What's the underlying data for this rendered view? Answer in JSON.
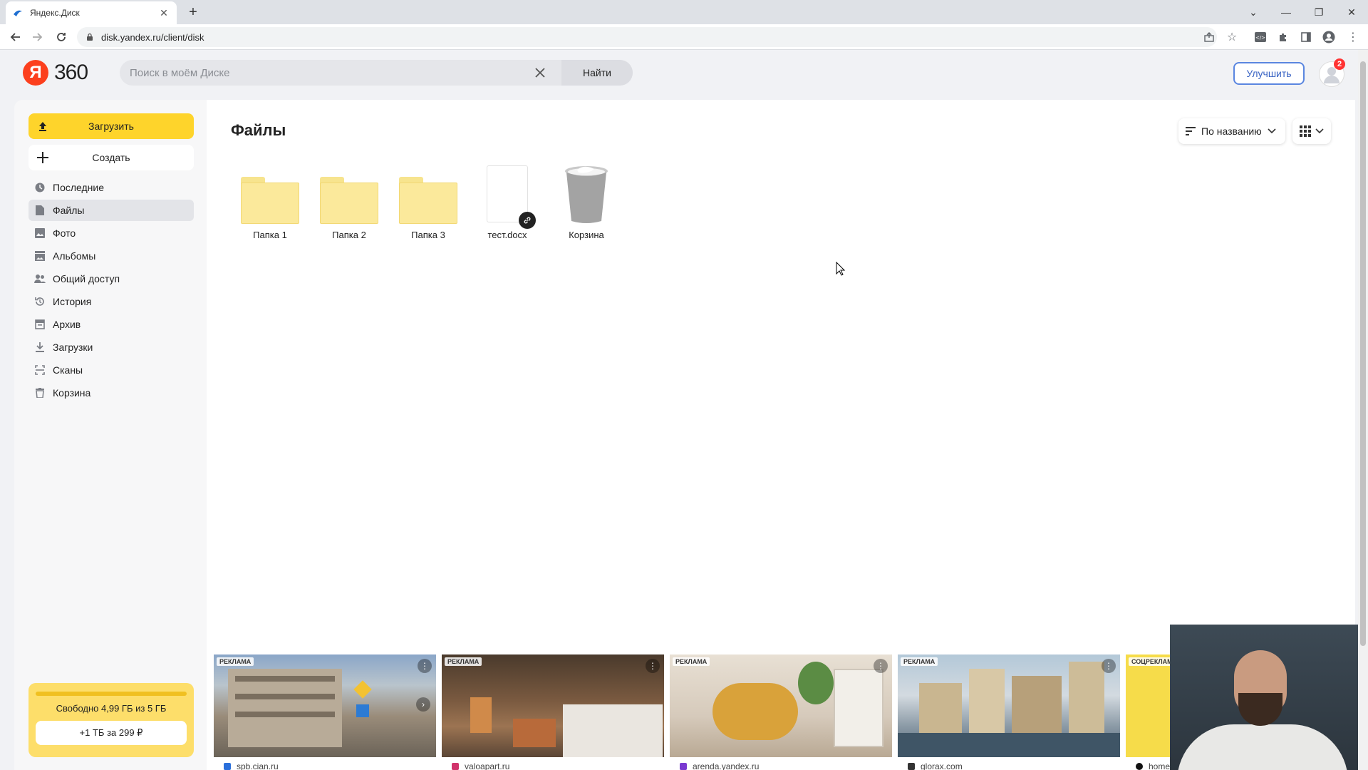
{
  "browser": {
    "tab_title": "Яндекс.Диск",
    "url": "disk.yandex.ru/client/disk"
  },
  "header": {
    "logo_letter": "Я",
    "logo_text": "360",
    "search_placeholder": "Поиск в моём Диске",
    "search_button": "Найти",
    "upgrade_label": "Улучшить",
    "notification_count": "2"
  },
  "sidebar": {
    "upload_label": "Загрузить",
    "create_label": "Создать",
    "items": [
      {
        "label": "Последние",
        "icon": "clock-icon"
      },
      {
        "label": "Файлы",
        "icon": "file-icon"
      },
      {
        "label": "Фото",
        "icon": "photo-icon"
      },
      {
        "label": "Альбомы",
        "icon": "album-icon"
      },
      {
        "label": "Общий доступ",
        "icon": "people-icon"
      },
      {
        "label": "История",
        "icon": "history-icon"
      },
      {
        "label": "Архив",
        "icon": "archive-icon"
      },
      {
        "label": "Загрузки",
        "icon": "download-icon"
      },
      {
        "label": "Сканы",
        "icon": "scan-icon"
      },
      {
        "label": "Корзина",
        "icon": "trash-icon"
      }
    ],
    "active_item": "Файлы",
    "storage_text": "Свободно 4,99 ГБ из 5 ГБ",
    "storage_offer": "+1 ТБ за 299 ₽"
  },
  "main": {
    "title": "Файлы",
    "sort_label": "По названию",
    "files": [
      {
        "name": "Папка 1",
        "type": "folder"
      },
      {
        "name": "Папка 2",
        "type": "folder"
      },
      {
        "name": "Папка 3",
        "type": "folder"
      },
      {
        "name": "тест.docx",
        "type": "document",
        "shared_link": true
      },
      {
        "name": "Корзина",
        "type": "trash"
      }
    ]
  },
  "ads": [
    {
      "label": "РЕКЛАМА",
      "domain": "spb.cian.ru"
    },
    {
      "label": "РЕКЛАМА",
      "domain": "valoapart.ru"
    },
    {
      "label": "РЕКЛАМА",
      "domain": "arenda.yandex.ru"
    },
    {
      "label": "РЕКЛАМА",
      "domain": "glorax.com"
    },
    {
      "label": "СОЦРЕКЛАМ",
      "domain": "home"
    }
  ],
  "colors": {
    "accent_yellow": "#fed42b",
    "brand_red": "#fc3f1d",
    "folder_yellow": "#fbe99b",
    "upgrade_blue": "#3a64c4"
  }
}
